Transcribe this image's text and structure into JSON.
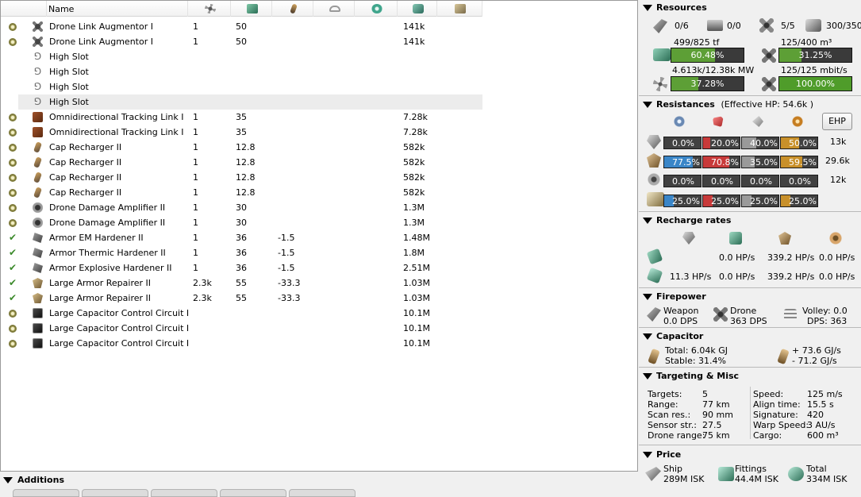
{
  "header": {
    "name_label": "Name"
  },
  "modules": [
    {
      "state": "offline",
      "icon": "drone-icon",
      "name": "Drone Link Augmentor I",
      "c1": "1",
      "c2": "50",
      "c3": "",
      "price": "141k"
    },
    {
      "state": "offline",
      "icon": "drone-icon",
      "name": "Drone Link Augmentor I",
      "c1": "1",
      "c2": "50",
      "c3": "",
      "price": "141k"
    },
    {
      "state": "",
      "icon": "slot-icon",
      "name": "High Slot",
      "c1": "",
      "c2": "",
      "c3": "",
      "price": ""
    },
    {
      "state": "",
      "icon": "slot-icon",
      "name": "High Slot",
      "c1": "",
      "c2": "",
      "c3": "",
      "price": ""
    },
    {
      "state": "",
      "icon": "slot-icon",
      "name": "High Slot",
      "c1": "",
      "c2": "",
      "c3": "",
      "price": ""
    },
    {
      "state": "",
      "icon": "slot-icon",
      "name": "High Slot",
      "c1": "",
      "c2": "",
      "c3": "",
      "price": ""
    },
    {
      "state": "offline",
      "icon": "link-icon",
      "name": "Omnidirectional Tracking Link I",
      "c1": "1",
      "c2": "35",
      "c3": "",
      "price": "7.28k"
    },
    {
      "state": "offline",
      "icon": "link-icon",
      "name": "Omnidirectional Tracking Link I",
      "c1": "1",
      "c2": "35",
      "c3": "",
      "price": "7.28k"
    },
    {
      "state": "offline",
      "icon": "cap-icon",
      "name": "Cap Recharger II",
      "c1": "1",
      "c2": "12.8",
      "c3": "",
      "price": "582k"
    },
    {
      "state": "offline",
      "icon": "cap-icon",
      "name": "Cap Recharger II",
      "c1": "1",
      "c2": "12.8",
      "c3": "",
      "price": "582k"
    },
    {
      "state": "offline",
      "icon": "cap-icon",
      "name": "Cap Recharger II",
      "c1": "1",
      "c2": "12.8",
      "c3": "",
      "price": "582k"
    },
    {
      "state": "offline",
      "icon": "cap-icon",
      "name": "Cap Recharger II",
      "c1": "1",
      "c2": "12.8",
      "c3": "",
      "price": "582k"
    },
    {
      "state": "offline",
      "icon": "dda-icon",
      "name": "Drone Damage Amplifier II",
      "c1": "1",
      "c2": "30",
      "c3": "",
      "price": "1.3M"
    },
    {
      "state": "offline",
      "icon": "dda-icon",
      "name": "Drone Damage Amplifier II",
      "c1": "1",
      "c2": "30",
      "c3": "",
      "price": "1.3M"
    },
    {
      "state": "active",
      "icon": "hardener-icon",
      "name": "Armor EM Hardener II",
      "c1": "1",
      "c2": "36",
      "c3": "-1.5",
      "price": "1.48M"
    },
    {
      "state": "active",
      "icon": "hardener-icon",
      "name": "Armor Thermic Hardener II",
      "c1": "1",
      "c2": "36",
      "c3": "-1.5",
      "price": "1.8M"
    },
    {
      "state": "active",
      "icon": "hardener-icon",
      "name": "Armor Explosive Hardener II",
      "c1": "1",
      "c2": "36",
      "c3": "-1.5",
      "price": "2.51M"
    },
    {
      "state": "active",
      "icon": "repairer-icon",
      "name": "Large Armor Repairer II",
      "c1": "2.3k",
      "c2": "55",
      "c3": "-33.3",
      "price": "1.03M"
    },
    {
      "state": "active",
      "icon": "repairer-icon",
      "name": "Large Armor Repairer II",
      "c1": "2.3k",
      "c2": "55",
      "c3": "-33.3",
      "price": "1.03M"
    },
    {
      "state": "offline",
      "icon": "rig-icon",
      "name": "Large Capacitor Control Circuit I",
      "c1": "",
      "c2": "",
      "c3": "",
      "price": "10.1M"
    },
    {
      "state": "offline",
      "icon": "rig-icon",
      "name": "Large Capacitor Control Circuit I",
      "c1": "",
      "c2": "",
      "c3": "",
      "price": "10.1M"
    },
    {
      "state": "offline",
      "icon": "rig-icon",
      "name": "Large Capacitor Control Circuit I",
      "c1": "",
      "c2": "",
      "c3": "",
      "price": "10.1M"
    }
  ],
  "resources": {
    "title": "Resources",
    "turrets": "0/6",
    "launchers": "0/0",
    "drones_active": "5/5",
    "drone_bay": "300/350",
    "cpu_text": "499/825 tf",
    "cpu_pct": 0.6048,
    "cpu_label": "60.48%",
    "drone_bay_text": "125/400 m³",
    "drone_bay_pct": 0.3125,
    "drone_bay_label": "31.25%",
    "pg_text": "4.613k/12.38k MW",
    "pg_pct": 0.3728,
    "pg_label": "37.28%",
    "bandwidth_text": "125/125 mbit/s",
    "bandwidth_pct": 1.0,
    "bandwidth_label": "100.00%"
  },
  "resistances": {
    "title": "Resistances",
    "ehp_text": "(Effective HP: 54.6k )",
    "ehp_button": "EHP",
    "rows": [
      {
        "layer": "shield",
        "values": [
          "0.0%",
          "20.0%",
          "40.0%",
          "50.0%"
        ],
        "fracs": [
          0.0,
          0.2,
          0.4,
          0.5
        ],
        "hp": "13k"
      },
      {
        "layer": "armor",
        "values": [
          "77.5%",
          "70.8%",
          "35.0%",
          "59.5%"
        ],
        "fracs": [
          0.775,
          0.708,
          0.35,
          0.595
        ],
        "hp": "29.6k"
      },
      {
        "layer": "hull",
        "values": [
          "0.0%",
          "0.0%",
          "0.0%",
          "0.0%"
        ],
        "fracs": [
          0,
          0,
          0,
          0
        ],
        "hp": "12k"
      },
      {
        "layer": "damage-pattern",
        "values": [
          "25.0%",
          "25.0%",
          "25.0%",
          "25.0%"
        ],
        "fracs": [
          0.25,
          0.25,
          0.25,
          0.25
        ],
        "hp": ""
      }
    ],
    "colors": [
      "#3a86c8",
      "#c83a3a",
      "#9a9a9a",
      "#c8902a"
    ]
  },
  "recharge": {
    "title": "Recharge rates",
    "row1": [
      "0.0 HP/s",
      "339.2 HP/s",
      "0.0 HP/s"
    ],
    "row2": [
      "11.3 HP/s",
      "0.0 HP/s",
      "339.2 HP/s",
      "0.0 HP/s"
    ]
  },
  "firepower": {
    "title": "Firepower",
    "weapon_label": "Weapon",
    "weapon_dps": "0.0 DPS",
    "drone_label": "Drone",
    "drone_dps": "363 DPS",
    "volley": "Volley: 0.0",
    "dps": "DPS: 363"
  },
  "capacitor": {
    "title": "Capacitor",
    "total": "Total: 6.04k GJ",
    "stable": "Stable: 31.4%",
    "plus": "+ 73.6 GJ/s",
    "minus": "- 71.2 GJ/s"
  },
  "targeting": {
    "title": "Targeting & Misc",
    "left_labels": [
      "Targets:",
      "Range:",
      "Scan res.:",
      "Sensor str.:",
      "Drone range:"
    ],
    "left_values": [
      "5",
      "77 km",
      "90 mm",
      "27.5",
      "75 km"
    ],
    "right_labels": [
      "Speed:",
      "Align time:",
      "Signature:",
      "Warp Speed:",
      "Cargo:"
    ],
    "right_values": [
      "125 m/s",
      "15.5 s",
      "420",
      "3 AU/s",
      "600 m³"
    ]
  },
  "price": {
    "title": "Price",
    "ship_label": "Ship",
    "ship_value": "289M ISK",
    "fittings_label": "Fittings",
    "fittings_value": "44.4M ISK",
    "total_label": "Total",
    "total_value": "334M ISK"
  },
  "additions": {
    "title": "Additions"
  }
}
